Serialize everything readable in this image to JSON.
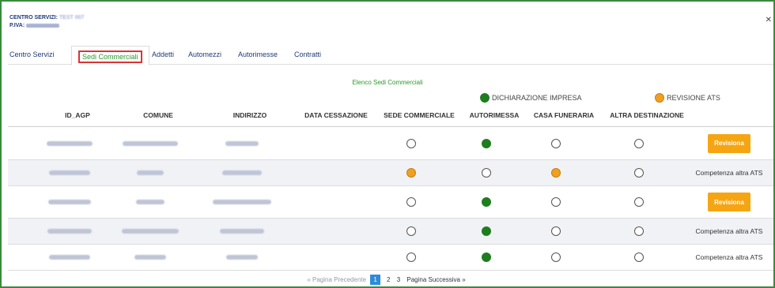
{
  "header": {
    "centro_label": "CENTRO SERVIZI:",
    "centro_value": "TEST 007",
    "piva_label": "P.IVA:",
    "piva_value": ""
  },
  "window": {
    "close_icon": "close-icon"
  },
  "tabs": [
    {
      "label": "Centro Servizi",
      "active": false
    },
    {
      "label": "Sedi Commerciali",
      "active": true
    },
    {
      "label": "Addetti",
      "active": false
    },
    {
      "label": "Automezzi",
      "active": false
    },
    {
      "label": "Autorimesse",
      "active": false
    },
    {
      "label": "Contratti",
      "active": false
    }
  ],
  "list_title": "Elenco Sedi Commerciali",
  "legend": {
    "green_label": "DICHIARAZIONE IMPRESA",
    "green_color": "#1e7d1e",
    "orange_label": "REVISIONE ATS",
    "orange_color": "#f0a020"
  },
  "columns": [
    "ID_AGP",
    "COMUNE",
    "INDIRIZZO",
    "DATA CESSAZIONE",
    "SEDE COMMERCIALE",
    "AUTORIMESSA",
    "CASA FUNERARIA",
    "ALTRA DESTINAZIONE"
  ],
  "rows": [
    {
      "sede": "empty",
      "autorimessa": "green",
      "funeraria": "empty",
      "altra": "empty",
      "action": "button",
      "action_label": "Revisiona"
    },
    {
      "sede": "orange",
      "autorimessa": "empty",
      "funeraria": "orange",
      "altra": "empty",
      "action": "text",
      "action_label": "Competenza altra ATS"
    },
    {
      "sede": "empty",
      "autorimessa": "green",
      "funeraria": "empty",
      "altra": "empty",
      "action": "button",
      "action_label": "Revisiona"
    },
    {
      "sede": "empty",
      "autorimessa": "green",
      "funeraria": "empty",
      "altra": "empty",
      "action": "text",
      "action_label": "Competenza altra ATS"
    },
    {
      "sede": "empty",
      "autorimessa": "green",
      "funeraria": "empty",
      "altra": "empty",
      "action": "text",
      "action_label": "Competenza altra ATS"
    }
  ],
  "pagination": {
    "prev": "« Pagina Precedente",
    "pages": [
      "1",
      "2",
      "3"
    ],
    "current": "1",
    "next": "Pagina Successiva »"
  }
}
